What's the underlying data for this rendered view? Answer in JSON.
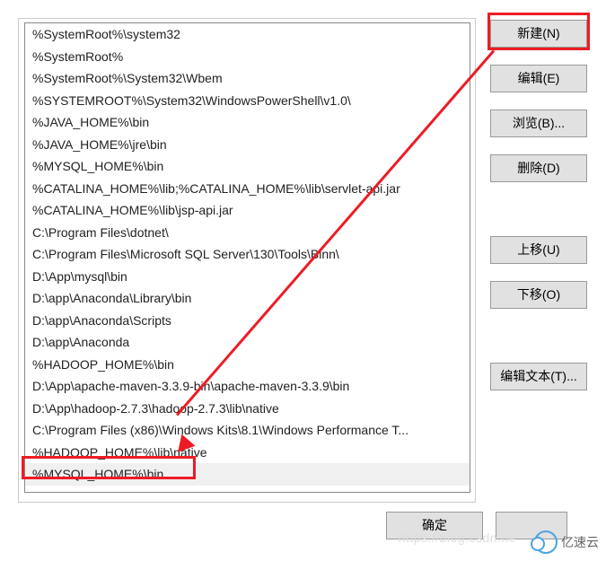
{
  "list": {
    "items": [
      "%SystemRoot%\\system32",
      "%SystemRoot%",
      "%SystemRoot%\\System32\\Wbem",
      "%SYSTEMROOT%\\System32\\WindowsPowerShell\\v1.0\\",
      "%JAVA_HOME%\\bin",
      "%JAVA_HOME%\\jre\\bin",
      "%MYSQL_HOME%\\bin",
      "%CATALINA_HOME%\\lib;%CATALINA_HOME%\\lib\\servlet-api.jar",
      "%CATALINA_HOME%\\lib\\jsp-api.jar",
      "C:\\Program Files\\dotnet\\",
      "C:\\Program Files\\Microsoft SQL Server\\130\\Tools\\Binn\\",
      "D:\\App\\mysql\\bin",
      "D:\\app\\Anaconda\\Library\\bin",
      "D:\\app\\Anaconda\\Scripts",
      "D:\\app\\Anaconda",
      "%HADOOP_HOME%\\bin",
      "D:\\App\\apache-maven-3.3.9-bin\\apache-maven-3.3.9\\bin",
      "D:\\App\\hadoop-2.7.3\\hadoop-2.7.3\\lib\\native",
      "C:\\Program Files (x86)\\Windows Kits\\8.1\\Windows Performance T...",
      "%HADOOP_HOME%\\lib\\native",
      "%MYSQL_HOME%\\bin"
    ],
    "selected_index": 20
  },
  "buttons": {
    "new": "新建(N)",
    "edit": "编辑(E)",
    "browse": "浏览(B)...",
    "delete": "删除(D)",
    "move_up": "上移(U)",
    "move_down": "下移(O)",
    "edit_text": "编辑文本(T)...",
    "ok": "确定"
  },
  "watermark": "https://blog.csdn.ne",
  "logo_text": "亿速云",
  "colors": {
    "annotation_red": "#ed1c24",
    "button_bg": "#e1e1e1"
  }
}
